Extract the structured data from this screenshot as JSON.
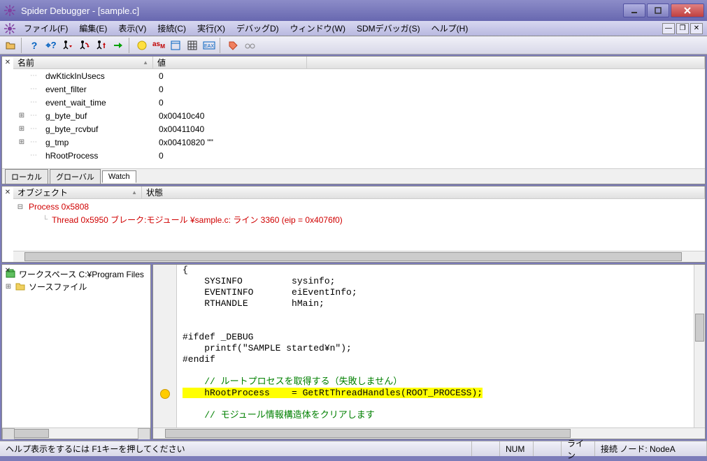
{
  "window": {
    "title": "Spider Debugger - [sample.c]"
  },
  "menu": {
    "file": "ファイル(F)",
    "edit": "編集(E)",
    "view": "表示(V)",
    "connect": "接続(C)",
    "run": "実行(X)",
    "debug": "デバッグD)",
    "window": "ウィンドウ(W)",
    "sdm": "SDMデバッガ(S)",
    "help": "ヘルプ(H)"
  },
  "vars": {
    "col_name": "名前",
    "col_value": "値",
    "rows": [
      {
        "name": "dwKtickInUsecs",
        "value": "0",
        "expand": ""
      },
      {
        "name": "event_filter",
        "value": "0",
        "expand": ""
      },
      {
        "name": "event_wait_time",
        "value": "0",
        "expand": ""
      },
      {
        "name": "g_byte_buf",
        "value": "0x00410c40",
        "expand": "+"
      },
      {
        "name": "g_byte_rcvbuf",
        "value": "0x00411040",
        "expand": "+"
      },
      {
        "name": "g_tmp",
        "value": "0x00410820 \"\"",
        "expand": "+"
      },
      {
        "name": "hRootProcess",
        "value": "0",
        "expand": ""
      }
    ],
    "tabs": {
      "local": "ローカル",
      "global": "グローバル",
      "watch": "Watch"
    }
  },
  "threads": {
    "col_object": "オブジェクト",
    "col_state": "状態",
    "process": "Process 0x5808",
    "thread": "Thread 0x5950    ブレーク:モジュール ¥sample.c: ライン 3360 (eip = 0x4076f0)"
  },
  "workspace": {
    "root": "ワークスペース C:¥Program Files",
    "folder": "ソースファイル"
  },
  "code": {
    "lines": [
      "{",
      "    SYSINFO         sysinfo;",
      "    EVENTINFO       eiEventInfo;",
      "    RTHANDLE        hMain;",
      "",
      "",
      "#ifdef _DEBUG",
      "    printf(\"SAMPLE started¥n\");",
      "#endif",
      "",
      "    // ルートプロセスを取得する（失敗しません）",
      "    hRootProcess    = GetRtThreadHandles(ROOT_PROCESS);",
      "",
      "    // モジュール情報構造体をクリアします"
    ]
  },
  "status": {
    "hint": "ヘルプ表示をするには F1キーを押してください",
    "num": "NUM",
    "line": "ライン",
    "conn": "接続 ノード: NodeA"
  }
}
